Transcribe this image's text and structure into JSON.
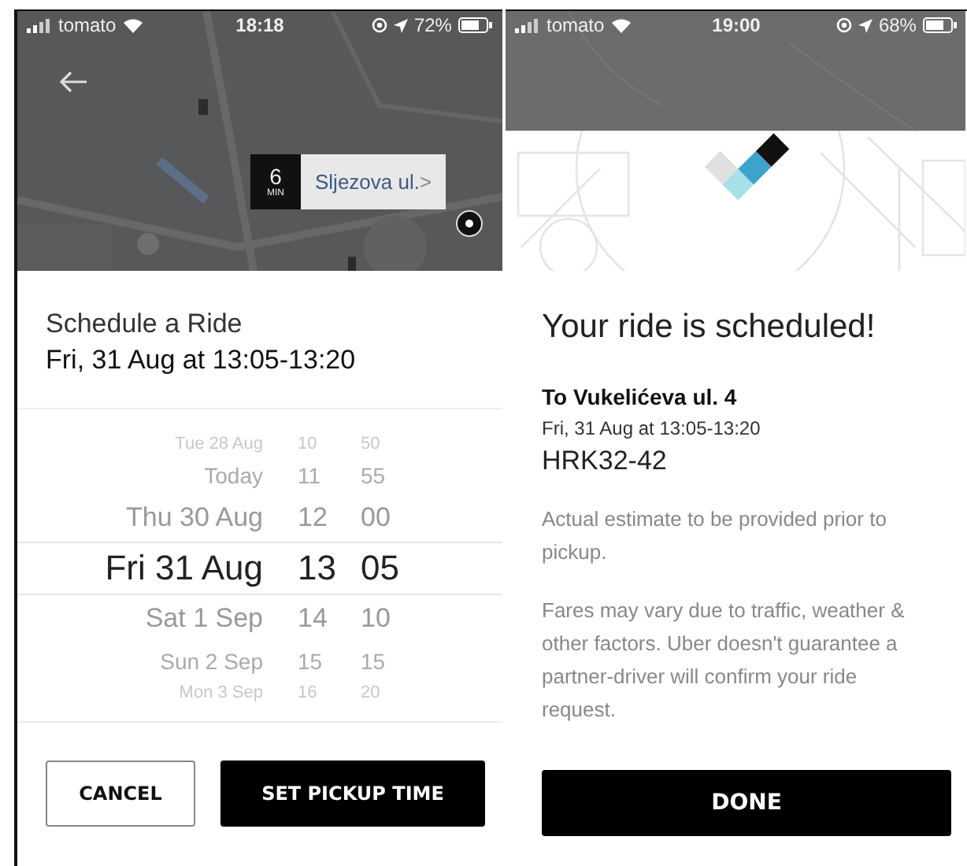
{
  "schedule_screen": {
    "status_bar": {
      "carrier": "tomato",
      "time": "18:18",
      "battery": "72%"
    },
    "eta_badge": {
      "minutes": "6",
      "unit": "MIN",
      "street": "Sljezova ul.",
      "chevron": ">"
    },
    "title": "Schedule a Ride",
    "selected_time": "Fri, 31 Aug at 13:05-13:20",
    "picker_rows": [
      {
        "day": "Tue 28 Aug",
        "hour": "10",
        "minute": "50",
        "selected": false
      },
      {
        "day": "Today",
        "hour": "11",
        "minute": "55",
        "selected": false
      },
      {
        "day": "Thu 30 Aug",
        "hour": "12",
        "minute": "00",
        "selected": false
      },
      {
        "day": "Fri 31 Aug",
        "hour": "13",
        "minute": "05",
        "selected": true
      },
      {
        "day": "Sat 1 Sep",
        "hour": "14",
        "minute": "10",
        "selected": false
      },
      {
        "day": "Sun 2 Sep",
        "hour": "15",
        "minute": "15",
        "selected": false
      },
      {
        "day": "Mon 3 Sep",
        "hour": "16",
        "minute": "20",
        "selected": false
      }
    ],
    "buttons": [
      {
        "label": "CANCEL",
        "kind": "outline"
      },
      {
        "label": "SET PICKUP TIME",
        "kind": "filled"
      }
    ]
  },
  "confirmation_screen": {
    "status_bar": {
      "carrier": "tomato",
      "time": "19:00",
      "battery": "68%"
    },
    "heading": "Your ride is scheduled!",
    "destination": "To Vukelićeva ul. 4",
    "time": "Fri, 31 Aug at 13:05-13:20",
    "fare": "HRK32-42",
    "notes": [
      "Actual estimate to be provided prior to pickup.",
      "Fares may vary due to traffic, weather & other factors. Uber doesn't guarantee a partner-driver will confirm your ride request."
    ],
    "buttons": [
      {
        "label": "DONE",
        "kind": "filled"
      }
    ]
  }
}
